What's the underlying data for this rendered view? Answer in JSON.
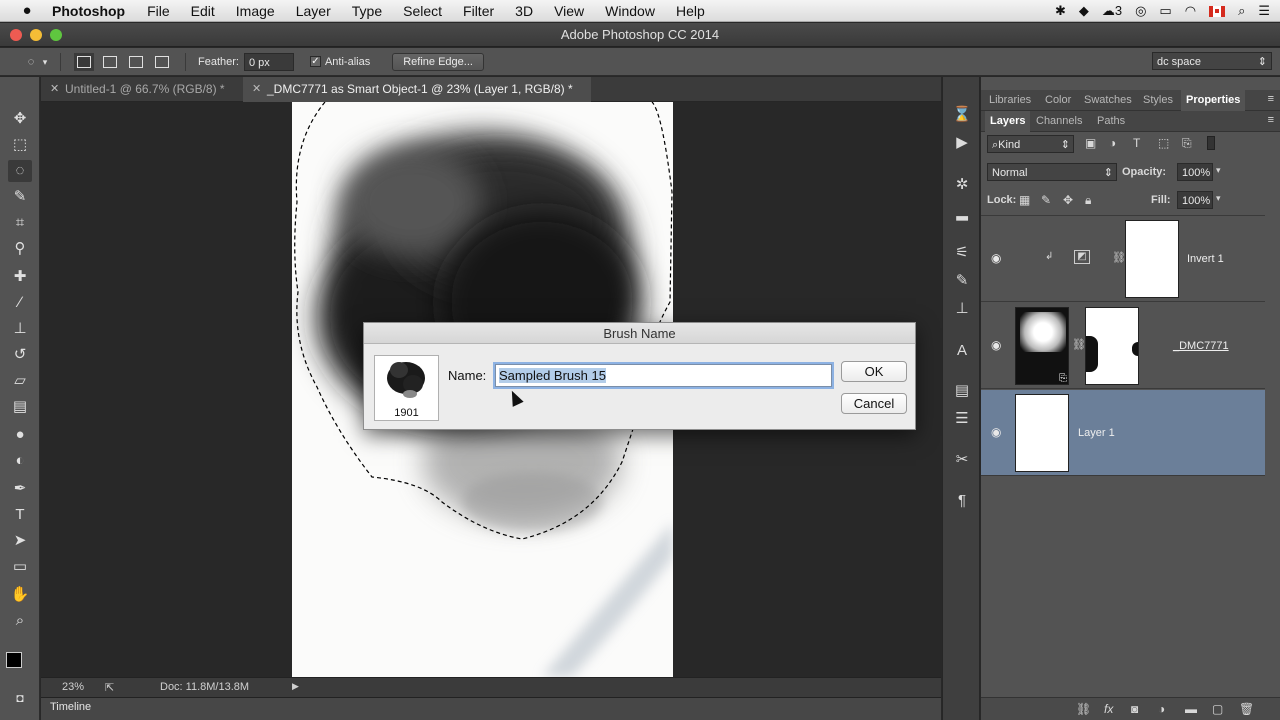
{
  "menubar": {
    "app_name": "Photoshop",
    "items": [
      "File",
      "Edit",
      "Image",
      "Layer",
      "Type",
      "Select",
      "Filter",
      "3D",
      "View",
      "Window",
      "Help"
    ],
    "notification_count": "3"
  },
  "window": {
    "title": "Adobe Photoshop CC 2014"
  },
  "options": {
    "feather_label": "Feather:",
    "feather_value": "0 px",
    "antialias_label": "Anti-alias",
    "refine_label": "Refine Edge...",
    "workspace": "dc space"
  },
  "tabs": [
    {
      "label": "Untitled-1 @ 66.7% (RGB/8) *"
    },
    {
      "label": "_DMC7771 as Smart Object-1 @ 23% (Layer 1, RGB/8) *"
    }
  ],
  "status": {
    "zoom": "23%",
    "doc": "Doc: 11.8M/13.8M"
  },
  "timeline": {
    "label": "Timeline"
  },
  "panels": {
    "top_tabs": [
      "Libraries",
      "Color",
      "Swatches",
      "Styles",
      "Properties"
    ],
    "layer_tabs": [
      "Layers",
      "Channels",
      "Paths"
    ],
    "kind": "Kind",
    "blend_mode": "Normal",
    "opacity_label": "Opacity:",
    "opacity_value": "100%",
    "lock_label": "Lock:",
    "fill_label": "Fill:",
    "fill_value": "100%",
    "layers": [
      {
        "name": "Invert 1"
      },
      {
        "name": "_DMC7771"
      },
      {
        "name": "Layer 1"
      }
    ]
  },
  "dialog": {
    "title": "Brush Name",
    "name_label": "Name:",
    "name_value": "Sampled Brush 15",
    "size": "1901",
    "ok": "OK",
    "cancel": "Cancel"
  },
  "colors": {
    "panel": "#535353",
    "canvas": "#282828",
    "selected_layer": "#6b7f99",
    "close_button": "#ee5b52",
    "minimize_button": "#f4bd36",
    "zoom_button": "#5fc63f"
  }
}
